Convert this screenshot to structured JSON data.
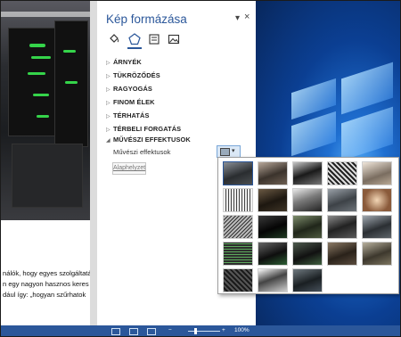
{
  "panel": {
    "title": "Kép formázása",
    "pin_icon": "dropdown-arrow-icon",
    "close_label": "×",
    "tabs": [
      {
        "name": "fill-line-tab",
        "icon": "paint-bucket-icon"
      },
      {
        "name": "effects-tab",
        "icon": "pentagon-icon",
        "active": true
      },
      {
        "name": "layout-size-tab",
        "icon": "layout-size-icon"
      },
      {
        "name": "picture-tab",
        "icon": "picture-icon"
      }
    ],
    "sections": [
      {
        "label": "ÁRNYÉK",
        "expanded": false
      },
      {
        "label": "TÜKRÖZŐDÉS",
        "expanded": false
      },
      {
        "label": "RAGYOGÁS",
        "expanded": false
      },
      {
        "label": "FINOM ÉLEK",
        "expanded": false
      },
      {
        "label": "TÉRHATÁS",
        "expanded": false
      },
      {
        "label": "TÉRBELI FORGATÁS",
        "expanded": false
      },
      {
        "label": "MŰVÉSZI EFFEKTUSOK",
        "expanded": true
      }
    ],
    "artistic_effects_label": "Művészi effektusok",
    "reset_label": "Alaphelyzet"
  },
  "document": {
    "lines": [
      "nálók, hogy egyes szolgáltatá",
      "n egy nagyon hasznos keres",
      "dául így: „hogyan szűrhatok"
    ]
  },
  "gallery": {
    "rows": 5,
    "cols": 5,
    "count": 23
  },
  "statusbar": {
    "zoom": "100%",
    "minus": "−",
    "plus": "+"
  },
  "colors": {
    "accent": "#2b579a",
    "selection": "#dbe8f6"
  }
}
